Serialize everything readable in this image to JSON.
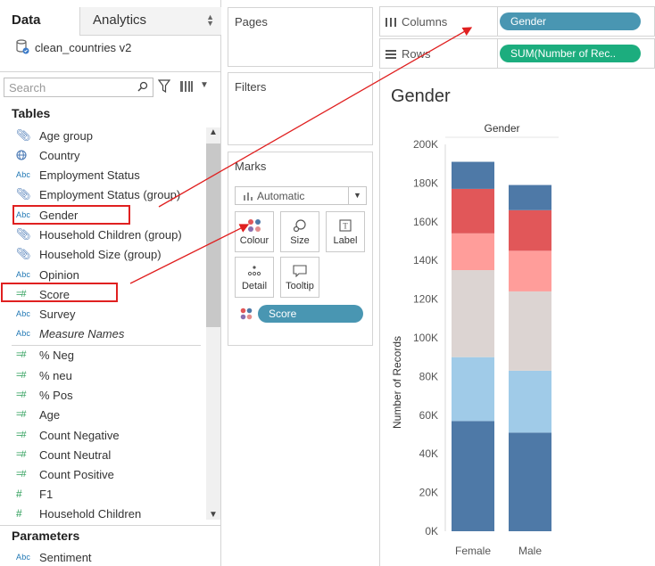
{
  "data_pane": {
    "tabs": [
      {
        "label": "Data",
        "active": true
      },
      {
        "label": "Analytics",
        "active": false
      }
    ],
    "datasource": "clean_countries v2",
    "search_placeholder": "Search",
    "tables_header": "Tables",
    "fields": [
      {
        "label": "Age group",
        "icon": "paperclip-icon"
      },
      {
        "label": "Country",
        "icon": "globe-icon"
      },
      {
        "label": "Employment Status",
        "icon": "abc-icon"
      },
      {
        "label": "Employment Status (group)",
        "icon": "paperclip-icon"
      },
      {
        "label": "Gender",
        "icon": "abc-icon",
        "highlighted": true
      },
      {
        "label": "Household Children (group)",
        "icon": "paperclip-icon"
      },
      {
        "label": "Household Size (group)",
        "icon": "paperclip-icon"
      },
      {
        "label": "Opinion",
        "icon": "abc-icon"
      },
      {
        "label": "Score",
        "icon": "bin-measure-icon",
        "highlighted": true
      },
      {
        "label": "Survey",
        "icon": "abc-icon"
      },
      {
        "label": "Measure Names",
        "icon": "abc-icon",
        "italic": true
      },
      {
        "label": "% Neg",
        "icon": "bin-measure-icon"
      },
      {
        "label": "% neu",
        "icon": "bin-measure-icon"
      },
      {
        "label": "% Pos",
        "icon": "bin-measure-icon"
      },
      {
        "label": "Age",
        "icon": "bin-measure-icon"
      },
      {
        "label": "Count Negative",
        "icon": "bin-measure-icon"
      },
      {
        "label": "Count Neutral",
        "icon": "bin-measure-icon"
      },
      {
        "label": "Count Positive",
        "icon": "bin-measure-icon"
      },
      {
        "label": "F1",
        "icon": "hash-icon"
      },
      {
        "label": "Household Children",
        "icon": "hash-icon"
      }
    ],
    "parameters_header": "Parameters",
    "parameters": [
      {
        "label": "Sentiment",
        "icon": "abc-icon"
      }
    ]
  },
  "cards": {
    "pages": "Pages",
    "filters": "Filters",
    "marks": {
      "title": "Marks",
      "mark_type": "Automatic",
      "buttons": [
        "Colour",
        "Size",
        "Label",
        "Detail",
        "Tooltip"
      ],
      "colour_pill": "Score"
    }
  },
  "shelves": {
    "columns_label": "Columns",
    "columns_pill": "Gender",
    "rows_label": "Rows",
    "rows_pill": "SUM(Number of Rec.."
  },
  "view": {
    "title": "Gender"
  },
  "colors": {
    "pill_blue": "#4996b2",
    "pill_green": "#1cad7e",
    "highlight_red": "#e02020"
  },
  "chart_data": {
    "type": "bar",
    "stacked": true,
    "header": "Gender",
    "ylabel": "Number of Records",
    "categories": [
      "Female",
      "Male"
    ],
    "ylim": [
      0,
      200000
    ],
    "y_ticks": [
      "0K",
      "20K",
      "40K",
      "60K",
      "80K",
      "100K",
      "120K",
      "140K",
      "160K",
      "180K",
      "200K"
    ],
    "segments": [
      {
        "color": "#4e79a7",
        "values": [
          57000,
          51000
        ]
      },
      {
        "color": "#a0cbe8",
        "values": [
          33000,
          32000
        ]
      },
      {
        "color": "#dcd4d2",
        "values": [
          45000,
          41000
        ]
      },
      {
        "color": "#ff9d9a",
        "values": [
          19000,
          21000
        ]
      },
      {
        "color": "#e15759",
        "values": [
          23000,
          21000
        ]
      },
      {
        "color": "#4e79a7",
        "values": [
          14000,
          13000
        ]
      }
    ]
  }
}
